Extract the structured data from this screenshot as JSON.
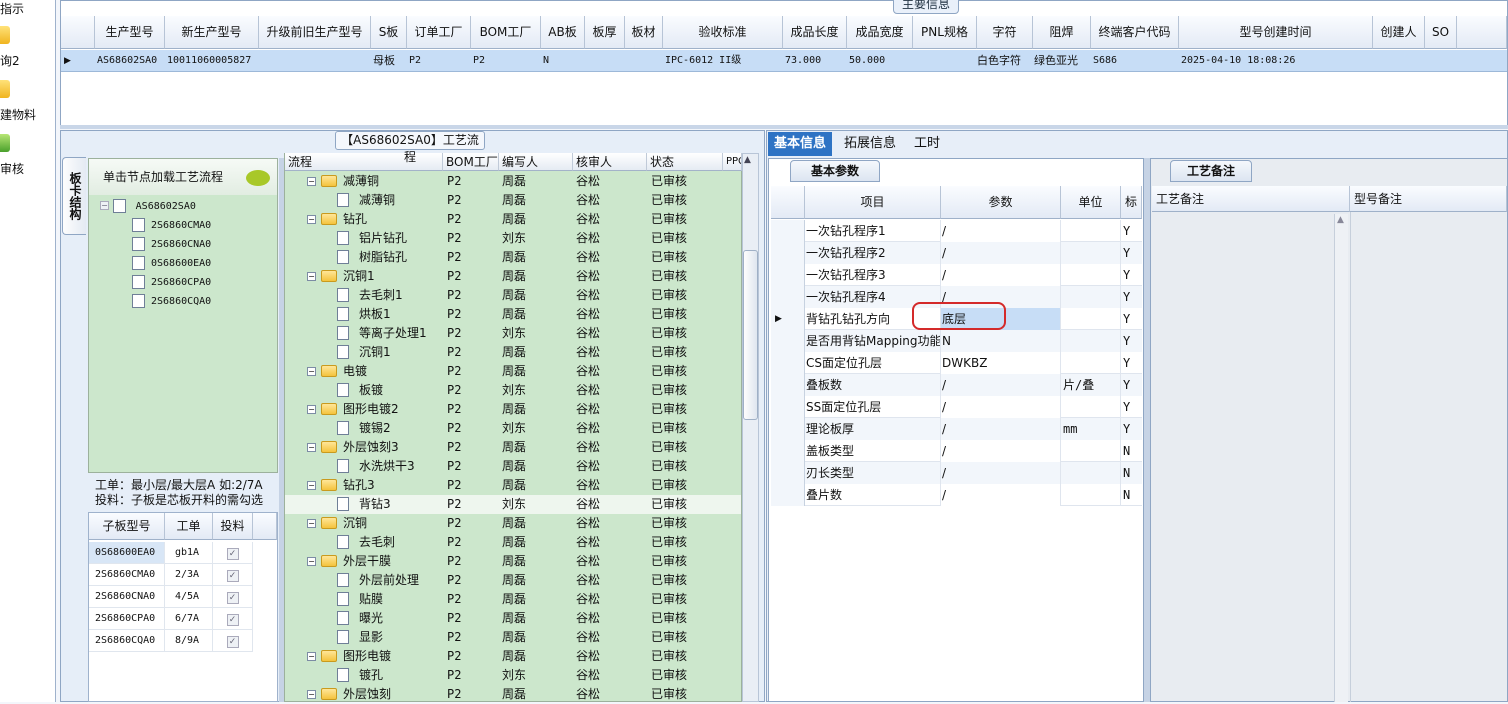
{
  "left_nav": {
    "items": [
      {
        "label": "指示"
      },
      {
        "label": "询2"
      },
      {
        "label": "建物料"
      },
      {
        "label": "审核"
      }
    ]
  },
  "main_grid": {
    "title": "主要信息",
    "columns": [
      "生产型号",
      "新生产型号",
      "升级前旧生产型号",
      "S板",
      "订单工厂",
      "BOM工厂",
      "AB板",
      "板厚",
      "板材",
      "验收标准",
      "成品长度",
      "成品宽度",
      "PNL规格",
      "字符",
      "阻焊",
      "终端客户代码",
      "型号创建时间",
      "创建人",
      "SO"
    ],
    "row": {
      "生产型号": "AS68602SA0",
      "新生产型号": "10011060005827",
      "升级前旧生产型号": "",
      "S板": "母板",
      "订单工厂": "P2",
      "BOM工厂": "P2",
      "AB板": "N",
      "板厚": "",
      "板材": "",
      "验收标准": "IPC-6012 II级",
      "成品长度": "73.000",
      "成品宽度": "50.000",
      "PNL规格": "",
      "字符": "白色字符",
      "阻焊": "绿色亚光",
      "终端客户代码": "S686",
      "型号创建时间": "2025-04-10 18:08:26",
      "创建人": "",
      "SO": ""
    }
  },
  "process_panel": {
    "title": "【AS68602SA0】工艺流程",
    "vertical_tab": "板卡结构",
    "tree_header": "单击节点加载工艺流程",
    "tree": [
      {
        "label": "AS68602SA0",
        "level": 0
      },
      {
        "label": "2S6860CMA0",
        "level": 1
      },
      {
        "label": "2S6860CNA0",
        "level": 1
      },
      {
        "label": "0S68600EA0",
        "level": 1
      },
      {
        "label": "2S6860CPA0",
        "level": 1
      },
      {
        "label": "2S6860CQA0",
        "level": 1
      }
    ],
    "info_line1": "工单：最小层/最大层A 如:2/7A",
    "info_line2": "投料：子板是芯板开料的需勾选",
    "sub_columns": [
      "子板型号",
      "工单",
      "投料"
    ],
    "sub_rows": [
      {
        "model": "0S68600EA0",
        "order": "gb1A",
        "feed": true
      },
      {
        "model": "2S6860CMA0",
        "order": "2/3A",
        "feed": true
      },
      {
        "model": "2S6860CNA0",
        "order": "4/5A",
        "feed": true
      },
      {
        "model": "2S6860CPA0",
        "order": "6/7A",
        "feed": true
      },
      {
        "model": "2S6860CQA0",
        "order": "8/9A",
        "feed": true
      }
    ]
  },
  "flow": {
    "columns": [
      "流程",
      "BOM工厂",
      "编写人",
      "核审人",
      "状态",
      "PPC"
    ],
    "rows": [
      {
        "name": "减薄铜",
        "level": 0,
        "bom": "P2",
        "writer": "周磊",
        "reviewer": "谷松",
        "status": "已审核"
      },
      {
        "name": "减薄铜",
        "level": 1,
        "bom": "P2",
        "writer": "周磊",
        "reviewer": "谷松",
        "status": "已审核"
      },
      {
        "name": "钻孔",
        "level": 0,
        "bom": "P2",
        "writer": "周磊",
        "reviewer": "谷松",
        "status": "已审核"
      },
      {
        "name": "铝片钻孔",
        "level": 1,
        "bom": "P2",
        "writer": "刘东",
        "reviewer": "谷松",
        "status": "已审核"
      },
      {
        "name": "树脂钻孔",
        "level": 1,
        "bom": "P2",
        "writer": "周磊",
        "reviewer": "谷松",
        "status": "已审核"
      },
      {
        "name": "沉铜1",
        "level": 0,
        "bom": "P2",
        "writer": "周磊",
        "reviewer": "谷松",
        "status": "已审核"
      },
      {
        "name": "去毛刺1",
        "level": 1,
        "bom": "P2",
        "writer": "周磊",
        "reviewer": "谷松",
        "status": "已审核"
      },
      {
        "name": "烘板1",
        "level": 1,
        "bom": "P2",
        "writer": "周磊",
        "reviewer": "谷松",
        "status": "已审核"
      },
      {
        "name": "等离子处理1",
        "level": 1,
        "bom": "P2",
        "writer": "刘东",
        "reviewer": "谷松",
        "status": "已审核"
      },
      {
        "name": "沉铜1",
        "level": 1,
        "bom": "P2",
        "writer": "周磊",
        "reviewer": "谷松",
        "status": "已审核"
      },
      {
        "name": "电镀",
        "level": 0,
        "bom": "P2",
        "writer": "周磊",
        "reviewer": "谷松",
        "status": "已审核"
      },
      {
        "name": "板镀",
        "level": 1,
        "bom": "P2",
        "writer": "刘东",
        "reviewer": "谷松",
        "status": "已审核"
      },
      {
        "name": "图形电镀2",
        "level": 0,
        "bom": "P2",
        "writer": "周磊",
        "reviewer": "谷松",
        "status": "已审核"
      },
      {
        "name": "镀锡2",
        "level": 1,
        "bom": "P2",
        "writer": "刘东",
        "reviewer": "谷松",
        "status": "已审核"
      },
      {
        "name": "外层蚀刻3",
        "level": 0,
        "bom": "P2",
        "writer": "周磊",
        "reviewer": "谷松",
        "status": "已审核"
      },
      {
        "name": "水洗烘干3",
        "level": 1,
        "bom": "P2",
        "writer": "周磊",
        "reviewer": "谷松",
        "status": "已审核"
      },
      {
        "name": "钻孔3",
        "level": 0,
        "bom": "P2",
        "writer": "周磊",
        "reviewer": "谷松",
        "status": "已审核"
      },
      {
        "name": "背钻3",
        "level": 1,
        "bom": "P2",
        "writer": "刘东",
        "reviewer": "谷松",
        "status": "已审核",
        "selected": true
      },
      {
        "name": "沉铜",
        "level": 0,
        "bom": "P2",
        "writer": "周磊",
        "reviewer": "谷松",
        "status": "已审核"
      },
      {
        "name": "去毛刺",
        "level": 1,
        "bom": "P2",
        "writer": "周磊",
        "reviewer": "谷松",
        "status": "已审核"
      },
      {
        "name": "外层干膜",
        "level": 0,
        "bom": "P2",
        "writer": "周磊",
        "reviewer": "谷松",
        "status": "已审核"
      },
      {
        "name": "外层前处理",
        "level": 1,
        "bom": "P2",
        "writer": "周磊",
        "reviewer": "谷松",
        "status": "已审核"
      },
      {
        "name": "贴膜",
        "level": 1,
        "bom": "P2",
        "writer": "周磊",
        "reviewer": "谷松",
        "status": "已审核"
      },
      {
        "name": "曝光",
        "level": 1,
        "bom": "P2",
        "writer": "周磊",
        "reviewer": "谷松",
        "status": "已审核"
      },
      {
        "name": "显影",
        "level": 1,
        "bom": "P2",
        "writer": "周磊",
        "reviewer": "谷松",
        "status": "已审核"
      },
      {
        "name": "图形电镀",
        "level": 0,
        "bom": "P2",
        "writer": "周磊",
        "reviewer": "谷松",
        "status": "已审核"
      },
      {
        "name": "镀孔",
        "level": 1,
        "bom": "P2",
        "writer": "刘东",
        "reviewer": "谷松",
        "status": "已审核"
      },
      {
        "name": "外层蚀刻",
        "level": 0,
        "bom": "P2",
        "writer": "周磊",
        "reviewer": "谷松",
        "status": "已审核"
      }
    ]
  },
  "right_tabs": [
    "基本信息",
    "拓展信息",
    "工时"
  ],
  "basic": {
    "tab": "基本参数",
    "columns": [
      "项目",
      "参数",
      "单位",
      "标"
    ],
    "rows": [
      {
        "item": "一次钻孔程序1",
        "param": "/",
        "unit": "",
        "flag": "Y"
      },
      {
        "item": "一次钻孔程序2",
        "param": "/",
        "unit": "",
        "flag": "Y"
      },
      {
        "item": "一次钻孔程序3",
        "param": "/",
        "unit": "",
        "flag": "Y"
      },
      {
        "item": "一次钻孔程序4",
        "param": "/",
        "unit": "",
        "flag": "Y"
      },
      {
        "item": "背钻孔钻孔方向",
        "param": "底层",
        "unit": "",
        "flag": "Y",
        "selected": true
      },
      {
        "item": "是否用背钻Mapping功能",
        "param": "N",
        "unit": "",
        "flag": "Y"
      },
      {
        "item": "CS面定位孔层",
        "param": "DWKBZ",
        "unit": "",
        "flag": "Y"
      },
      {
        "item": "叠板数",
        "param": "/",
        "unit": "片/叠",
        "flag": "Y"
      },
      {
        "item": "SS面定位孔层",
        "param": "/",
        "unit": "",
        "flag": "Y"
      },
      {
        "item": "理论板厚",
        "param": "/",
        "unit": "mm",
        "flag": "Y"
      },
      {
        "item": "盖板类型",
        "param": "/",
        "unit": "",
        "flag": "N"
      },
      {
        "item": "刃长类型",
        "param": "/",
        "unit": "",
        "flag": "N"
      },
      {
        "item": "叠片数",
        "param": "/",
        "unit": "",
        "flag": "N"
      }
    ]
  },
  "notes": {
    "tab": "工艺备注",
    "col1": "工艺备注",
    "col2": "型号备注"
  }
}
